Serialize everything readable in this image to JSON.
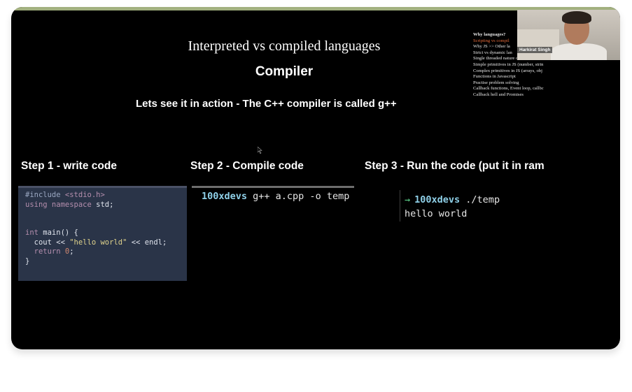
{
  "slide": {
    "title": "Interpreted vs compiled languages",
    "subtitle": "Compiler",
    "description": "Lets see it in action - The C++ compiler is called g++"
  },
  "steps": [
    {
      "label": "Step 1 - write code"
    },
    {
      "label": "Step 2 - Compile code"
    },
    {
      "label": "Step 3 - Run the code (put it in ram"
    }
  ],
  "code_step1": {
    "line1_pre": "#include ",
    "line1_header": "<stdio.h>",
    "line2_kw": "using namespace",
    "line2_rest": " std;",
    "line4_kw": "int",
    "line4_rest": " main() {",
    "line5_pre": "  cout << ",
    "line5_str": "\"hello world\"",
    "line5_post": " << endl;",
    "line6_kw": "  return",
    "line6_num": " 0",
    "line6_post": ";",
    "line7": "}"
  },
  "terminal_step2": {
    "prompt": "100xdevs",
    "command": " g++ a.cpp -o temp"
  },
  "terminal_step3": {
    "arrow": "→",
    "prompt": "100xdevs",
    "command": " ./temp",
    "output": "hello world"
  },
  "toc": {
    "heading": "Why languages?",
    "items": [
      "Scripting vs compil",
      "Why JS >> Other la",
      "Strict vs dynamic lan",
      "Single threaded nature of JS",
      "Simple primitives in JS (number, strin",
      "Complex primitives in JS (arrays, obj",
      "Functions in Javascript",
      "Practise problem solving",
      "Callback functions, Event loop, callbc",
      "Callback hell and Promises"
    ],
    "active_index": 0
  },
  "webcam": {
    "name": "Harkirat Singh"
  },
  "colors": {
    "topbar": "#a2b07f",
    "active_toc": "#e36a3a",
    "code_bg": "#2a3448"
  }
}
